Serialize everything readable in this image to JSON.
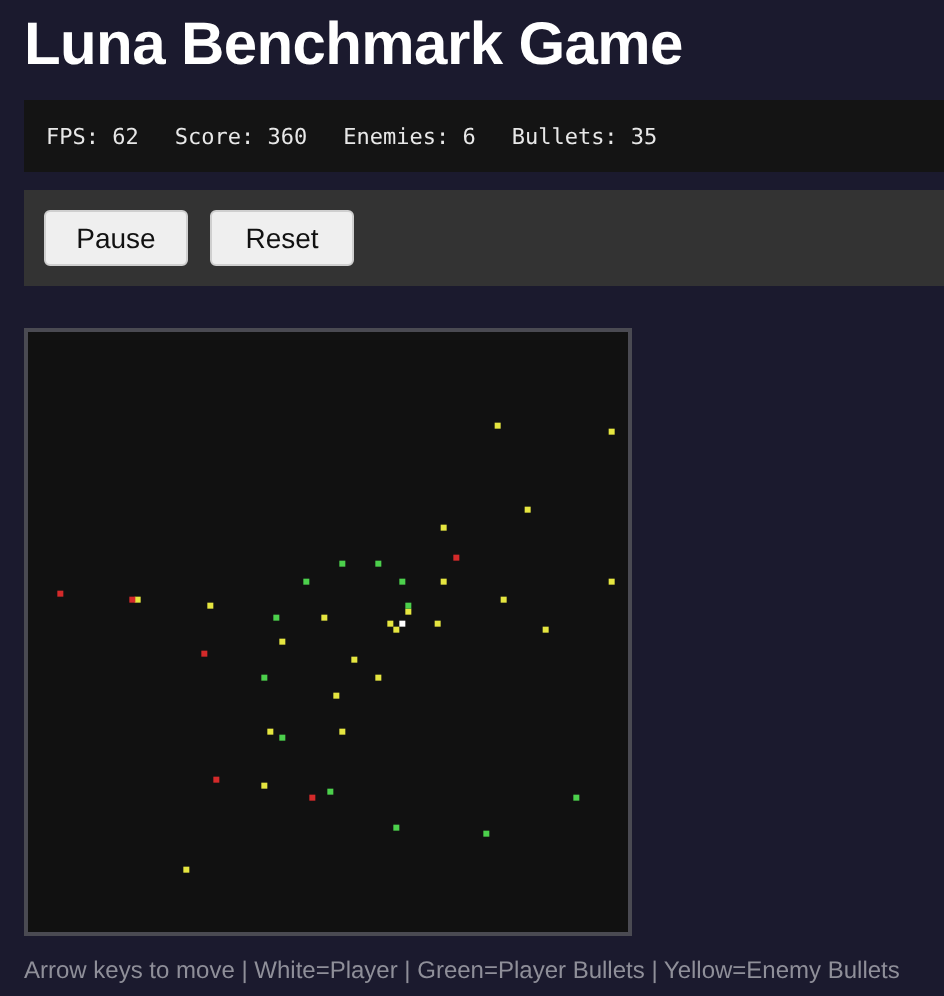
{
  "title": "Luna Benchmark Game",
  "stats": [
    "FPS: 62",
    "Score: 360",
    "Enemies: 6",
    "Bullets: 35"
  ],
  "buttons": [
    "Pause",
    "Reset"
  ],
  "legend": "Arrow keys to move | White=Player | Green=Player Bullets | Yellow=Enemy Bullets"
}
